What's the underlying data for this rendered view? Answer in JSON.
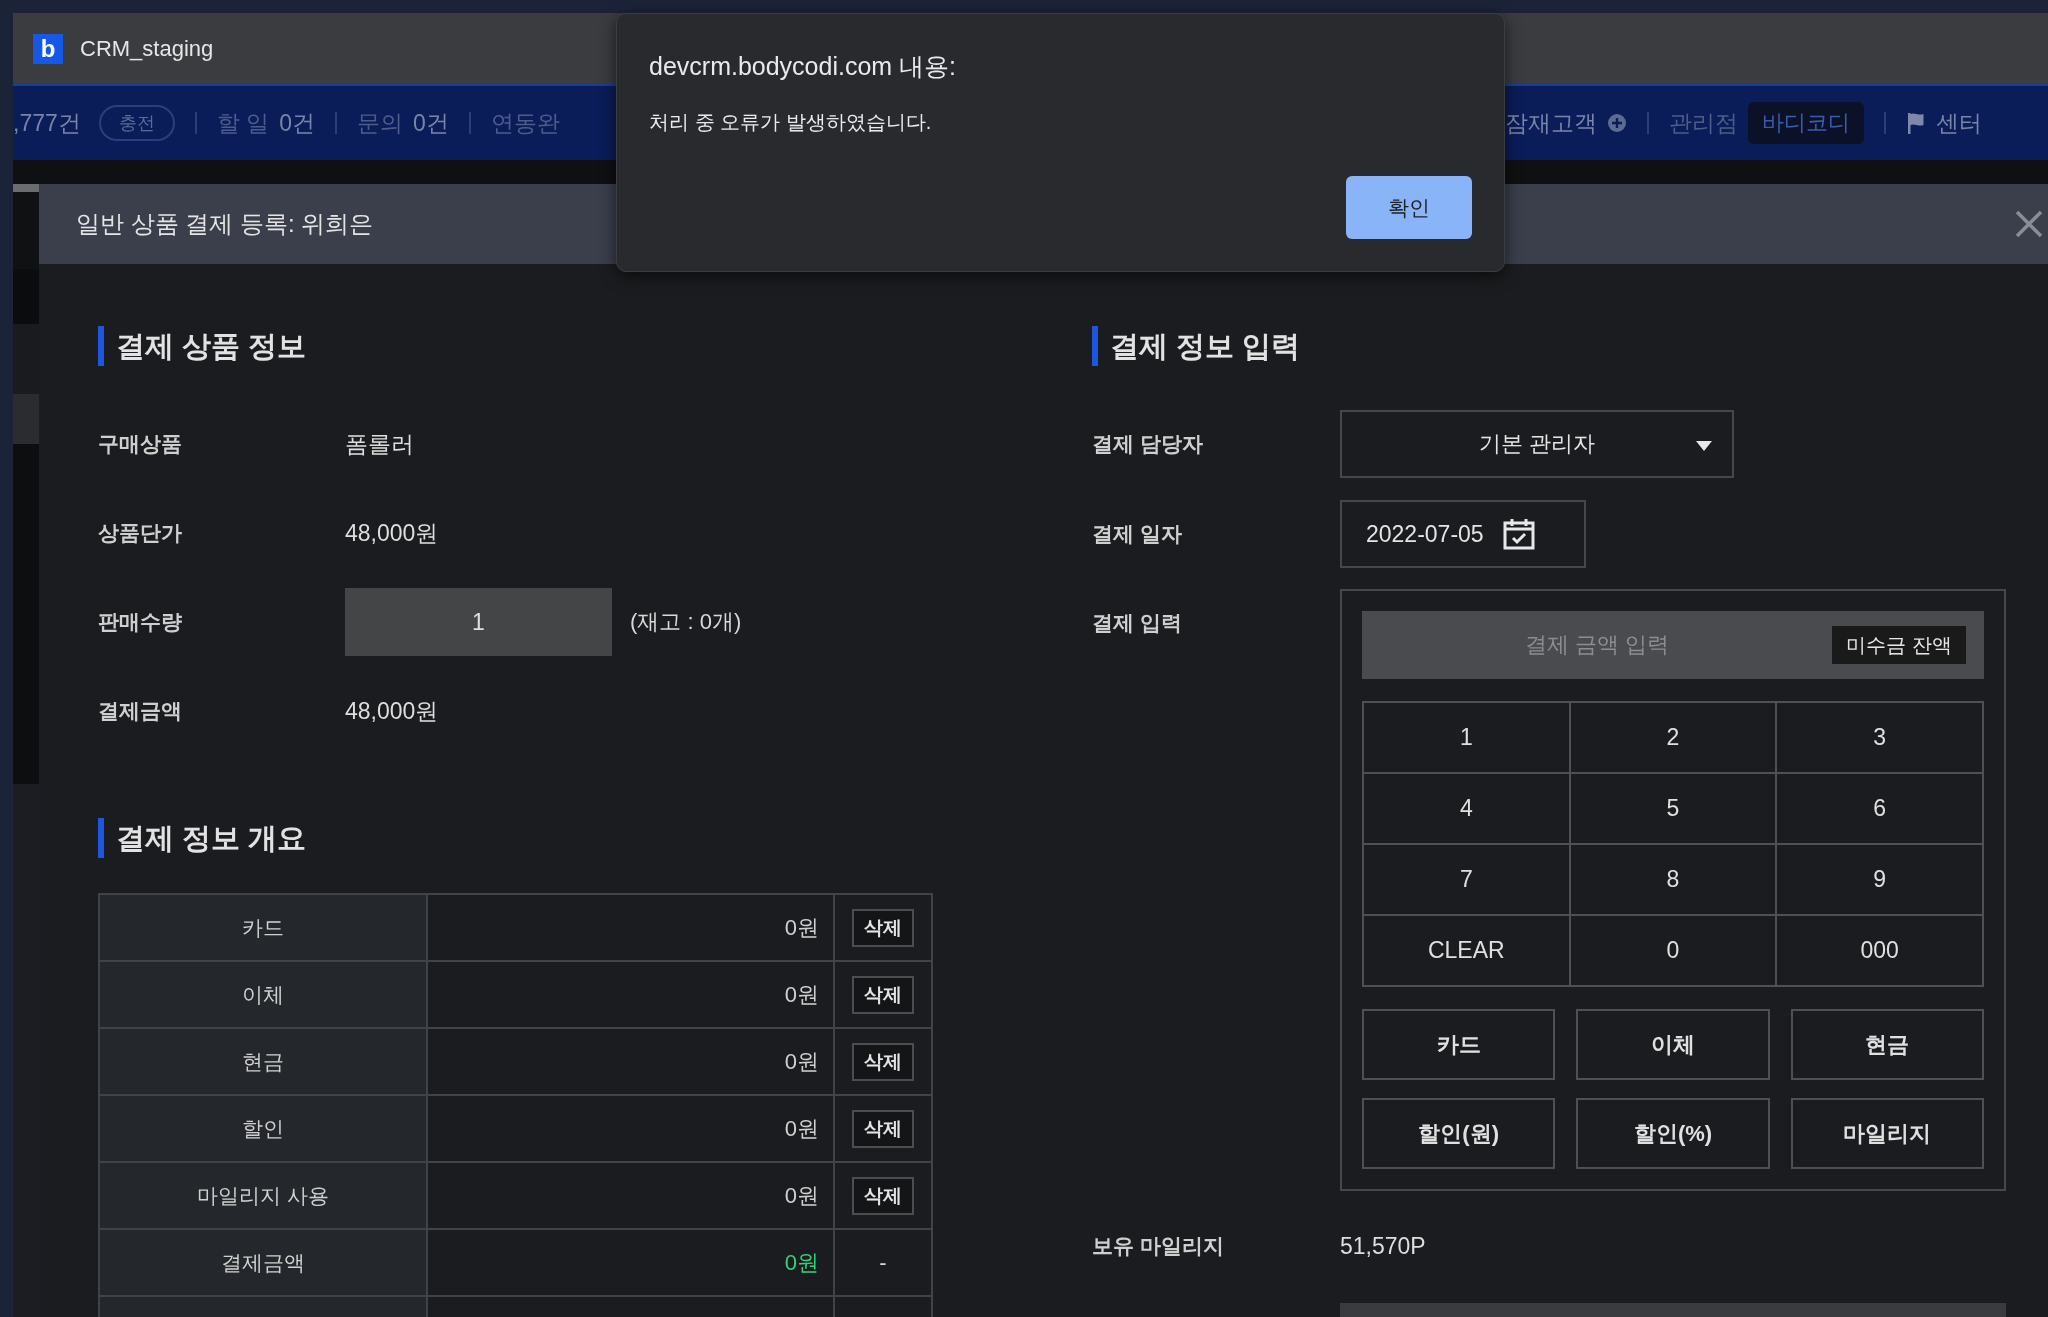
{
  "window": {
    "logo": "b",
    "title": "CRM_staging"
  },
  "nav_bar": {
    "left_items": [
      {
        "kind": "value",
        "text": ",777건"
      },
      {
        "kind": "pill",
        "text": "충전"
      },
      {
        "kind": "divider"
      },
      {
        "kind": "label",
        "text": "할 일"
      },
      {
        "kind": "value",
        "text": "0건"
      },
      {
        "kind": "divider"
      },
      {
        "kind": "label",
        "text": "문의"
      },
      {
        "kind": "value",
        "text": "0건"
      },
      {
        "kind": "divider"
      },
      {
        "kind": "label",
        "text": "연동완"
      }
    ],
    "right_items": [
      {
        "kind": "value",
        "text": "잠재고객"
      },
      {
        "kind": "add"
      },
      {
        "kind": "divider"
      },
      {
        "kind": "label",
        "text": "관리점"
      },
      {
        "kind": "dark_pill",
        "text": "바디코디"
      },
      {
        "kind": "divider"
      },
      {
        "kind": "flag"
      },
      {
        "kind": "value",
        "text": "센터"
      }
    ]
  },
  "dialog": {
    "title": "devcrm.bodycodi.com 내용:",
    "message": "처리 중 오류가 발생하였습니다.",
    "button": "확인"
  },
  "modal": {
    "title": "일반 상품 결제 등록: 위희은",
    "product_section": {
      "heading": "결제 상품 정보",
      "fields": [
        {
          "kind": "text",
          "label": "구매상품",
          "value": "폼롤러"
        },
        {
          "kind": "text",
          "label": "상품단가",
          "value": "48,000원"
        },
        {
          "kind": "quantity",
          "label": "판매수량",
          "value": "1",
          "note": "(재고 : 0개)"
        },
        {
          "kind": "text",
          "label": "결제금액",
          "value": "48,000원"
        }
      ]
    },
    "summary_section": {
      "heading": "결제 정보 개요",
      "rows": [
        {
          "kind": "deletable",
          "method": "카드",
          "amount": "0원",
          "action": "삭제"
        },
        {
          "kind": "deletable",
          "method": "이체",
          "amount": "0원",
          "action": "삭제"
        },
        {
          "kind": "deletable",
          "method": "현금",
          "amount": "0원",
          "action": "삭제"
        },
        {
          "kind": "deletable",
          "method": "할인",
          "amount": "0원",
          "action": "삭제"
        },
        {
          "kind": "deletable",
          "method": "마일리지 사용",
          "amount": "0원",
          "action": "삭제"
        },
        {
          "kind": "total",
          "method": "결제금액",
          "amount": "0원",
          "action": "-"
        }
      ]
    },
    "payment_section": {
      "heading": "결제 정보 입력",
      "manager": {
        "label": "결제 담당자",
        "value": "기본 관리자"
      },
      "date": {
        "label": "결제 일자",
        "value": "2022-07-05"
      },
      "input": {
        "label": "결제 입력",
        "placeholder": "결제 금액 입력",
        "balance_button": "미수금 잔액",
        "keys": [
          "1",
          "2",
          "3",
          "4",
          "5",
          "6",
          "7",
          "8",
          "9",
          "CLEAR",
          "0",
          "000"
        ],
        "methods": [
          "카드",
          "이체",
          "현금",
          "할인(원)",
          "할인(%)",
          "마일리지"
        ]
      },
      "mileage": {
        "label": "보유 마일리지",
        "value": "51,570P"
      }
    }
  }
}
